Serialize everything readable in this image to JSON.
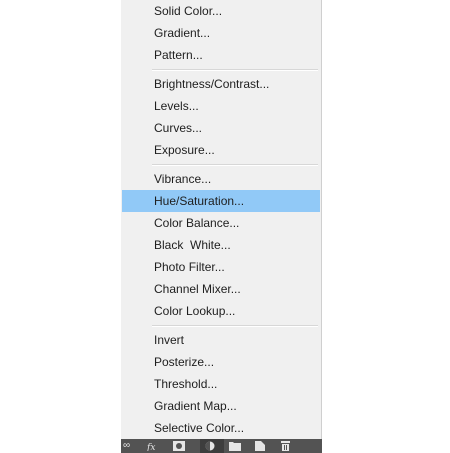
{
  "menu": {
    "highlight_color": "#91c9f7",
    "groups": [
      [
        "Solid Color...",
        "Gradient...",
        "Pattern..."
      ],
      [
        "Brightness/Contrast...",
        "Levels...",
        "Curves...",
        "Exposure..."
      ],
      [
        "Vibrance...",
        "Hue/Saturation...",
        "Color Balance...",
        "Black  White...",
        "Photo Filter...",
        "Channel Mixer...",
        "Color Lookup..."
      ],
      [
        "Invert",
        "Posterize...",
        "Threshold...",
        "Gradient Map...",
        "Selective Color..."
      ]
    ],
    "highlighted_item": "Hue/Saturation..."
  },
  "layers_panel_bar": {
    "icons": [
      "link-layers-icon",
      "fx-icon",
      "add-mask-icon",
      "adjustment-layer-icon",
      "group-folder-icon",
      "new-layer-icon",
      "delete-layer-icon"
    ]
  }
}
